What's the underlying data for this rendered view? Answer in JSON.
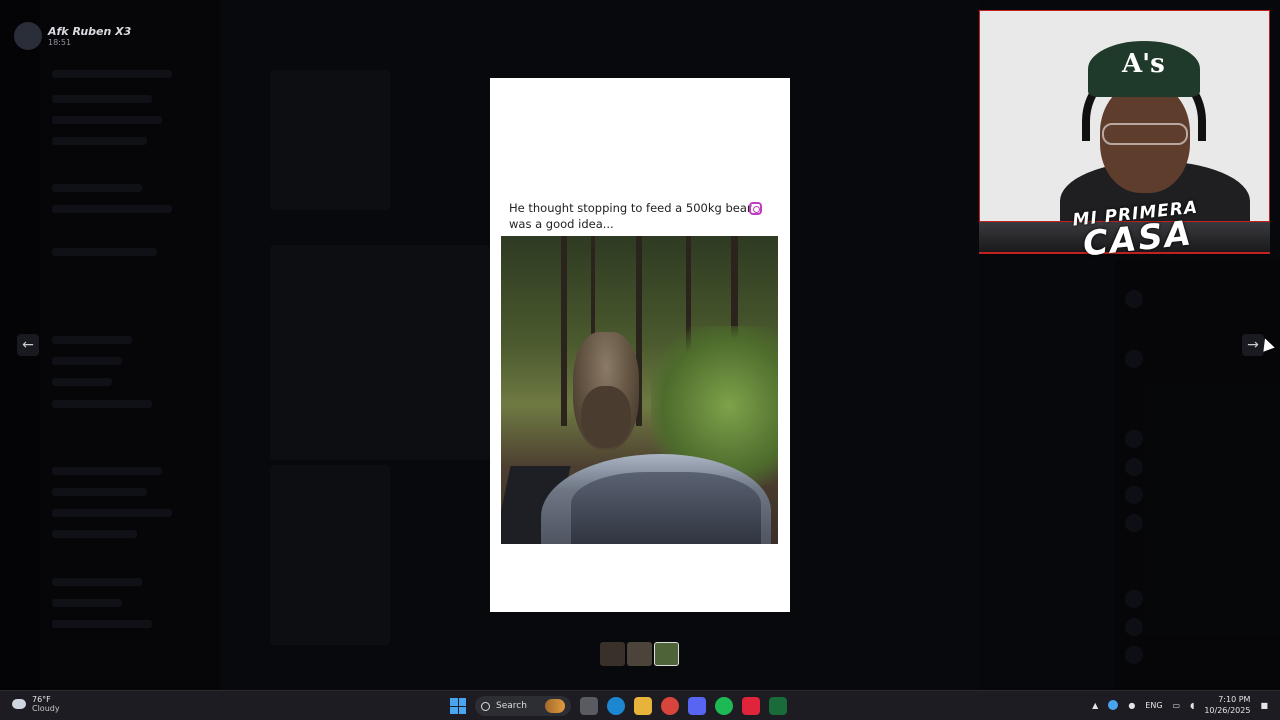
{
  "header": {
    "user_name": "Afk Ruben X3",
    "time": "18:51"
  },
  "viewer": {
    "caption": "He thought stopping to feed a 500kg bear was a good idea...",
    "prev_label": "←",
    "next_label": "→",
    "thumbnail_count": 3,
    "active_thumbnail": 3
  },
  "webcam_overlay": {
    "brand_top": "MI PRIMERA",
    "brand_bottom": "CASA"
  },
  "taskbar": {
    "weather_temp": "76°F",
    "weather_desc": "Cloudy",
    "search_label": "Search",
    "language": "ENG",
    "time": "7:10 PM",
    "date": "10/26/2025"
  },
  "colors": {
    "background": "#07080c",
    "modal": "#ffffff",
    "accent_red": "#c32020",
    "windows_blue": "#4aa5f0"
  },
  "icons": {
    "instagram": "instagram-icon",
    "prev": "arrow-left-icon",
    "next": "arrow-right-icon",
    "start": "windows-start-icon",
    "search": "search-icon"
  }
}
